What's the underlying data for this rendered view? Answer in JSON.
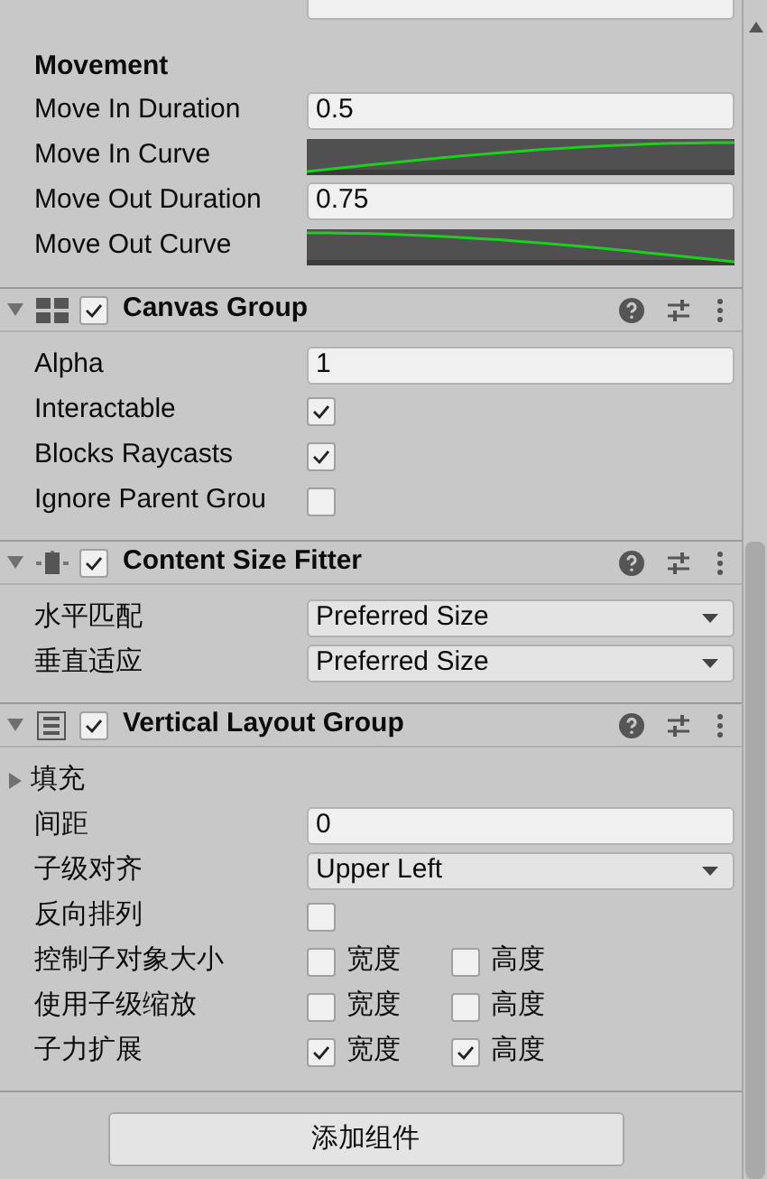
{
  "movement": {
    "heading": "Movement",
    "rows": [
      {
        "kind": "number",
        "label": "Move In Duration",
        "value": "0.5"
      },
      {
        "kind": "curve_up",
        "label": "Move In Curve"
      },
      {
        "kind": "number",
        "label": "Move Out Duration",
        "value": "0.75"
      },
      {
        "kind": "curve_down",
        "label": "Move Out Curve"
      }
    ]
  },
  "components": [
    {
      "title": "Canvas Group",
      "enabled": true,
      "expanded": true,
      "rows": [
        {
          "kind": "number",
          "label": "Alpha",
          "value": "1"
        },
        {
          "kind": "checkbox",
          "label": "Interactable",
          "checked": true
        },
        {
          "kind": "checkbox",
          "label": "Blocks Raycasts",
          "checked": true
        },
        {
          "kind": "checkbox",
          "label": "Ignore Parent Grou",
          "checked": false
        }
      ]
    },
    {
      "title": "Content Size Fitter",
      "enabled": true,
      "expanded": true,
      "rows": [
        {
          "kind": "dropdown",
          "label": "水平匹配",
          "value": "Preferred Size"
        },
        {
          "kind": "dropdown",
          "label": "垂直适应",
          "value": "Preferred Size"
        }
      ]
    },
    {
      "title": "Vertical Layout Group",
      "enabled": true,
      "expanded": true,
      "rows": [
        {
          "kind": "foldout",
          "label": "填充",
          "expanded": false
        },
        {
          "kind": "number",
          "label": "间距",
          "value": "0"
        },
        {
          "kind": "dropdown",
          "label": "子级对齐",
          "value": "Upper Left"
        },
        {
          "kind": "checkbox",
          "label": "反向排列",
          "checked": false
        },
        {
          "kind": "pair",
          "label": "控制子对象大小",
          "options": [
            {
              "label": "宽度",
              "checked": false
            },
            {
              "label": "高度",
              "checked": false
            }
          ]
        },
        {
          "kind": "pair",
          "label": "使用子级缩放",
          "options": [
            {
              "label": "宽度",
              "checked": false
            },
            {
              "label": "高度",
              "checked": false
            }
          ]
        },
        {
          "kind": "pair",
          "label": "子力扩展",
          "options": [
            {
              "label": "宽度",
              "checked": true
            },
            {
              "label": "高度",
              "checked": true
            }
          ]
        }
      ]
    }
  ],
  "add_button": "添加组件"
}
